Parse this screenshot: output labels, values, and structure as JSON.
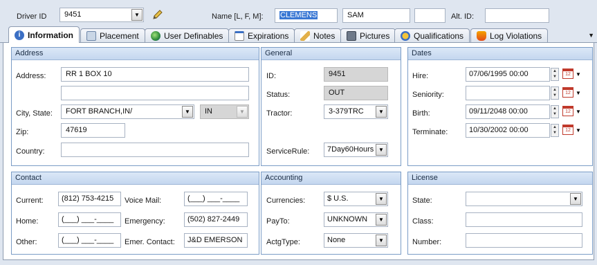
{
  "header": {
    "driver_id_label": "Driver ID",
    "driver_id_value": "9451",
    "name_label": "Name [L, F, M]:",
    "last_name": "CLEMENS",
    "first_name": "SAM",
    "middle_name": "",
    "alt_id_label": "Alt. ID:",
    "alt_id_value": ""
  },
  "tabs": [
    {
      "label": "Information",
      "icon": "info-icon",
      "active": true
    },
    {
      "label": "Placement",
      "icon": "placement-icon"
    },
    {
      "label": "User Definables",
      "icon": "user-definables-icon"
    },
    {
      "label": "Expirations",
      "icon": "calendar-icon"
    },
    {
      "label": "Notes",
      "icon": "pencil-icon"
    },
    {
      "label": "Pictures",
      "icon": "picture-icon"
    },
    {
      "label": "Qualifications",
      "icon": "qualifications-icon"
    },
    {
      "label": "Log Violations",
      "icon": "log-violations-icon"
    }
  ],
  "tab_overflow": "▼",
  "address": {
    "title": "Address",
    "address_label": "Address:",
    "address1": "RR 1 BOX 10",
    "address2": "",
    "city_state_label": "City, State:",
    "city_state": "FORT BRANCH,IN/",
    "state_code": "IN",
    "zip_label": "Zip:",
    "zip": "47619",
    "country_label": "Country:",
    "country": ""
  },
  "general": {
    "title": "General",
    "id_label": "ID:",
    "id": "9451",
    "status_label": "Status:",
    "status": "OUT",
    "tractor_label": "Tractor:",
    "tractor": "3-379TRC",
    "service_rule_label": "ServiceRule:",
    "service_rule": "7Day60Hours"
  },
  "dates": {
    "title": "Dates",
    "hire_label": "Hire:",
    "hire": "07/06/1995 00:00",
    "seniority_label": "Seniority:",
    "seniority": "",
    "birth_label": "Birth:",
    "birth": "09/11/2048 00:00",
    "terminate_label": "Terminate:",
    "terminate": "10/30/2002 00:00",
    "cal_day": "12"
  },
  "contact": {
    "title": "Contact",
    "current_label": "Current:",
    "current": "(812) 753-4215",
    "voicemail_label": "Voice Mail:",
    "voicemail": "(___) ___-____",
    "home_label": "Home:",
    "home": "(___) ___-____",
    "emergency_label": "Emergency:",
    "emergency": "(502) 827-2449",
    "other_label": "Other:",
    "other": "(___) ___-____",
    "emer_contact_label": "Emer. Contact:",
    "emer_contact": "J&D EMERSON"
  },
  "accounting": {
    "title": "Accounting",
    "currencies_label": "Currencies:",
    "currencies": "$ U.S.",
    "payto_label": "PayTo:",
    "payto": "UNKNOWN",
    "actgtype_label": "ActgType:",
    "actgtype": "None"
  },
  "license": {
    "title": "License",
    "state_label": "State:",
    "state": "",
    "class_label": "Class:",
    "class": "",
    "number_label": "Number:",
    "number": ""
  }
}
